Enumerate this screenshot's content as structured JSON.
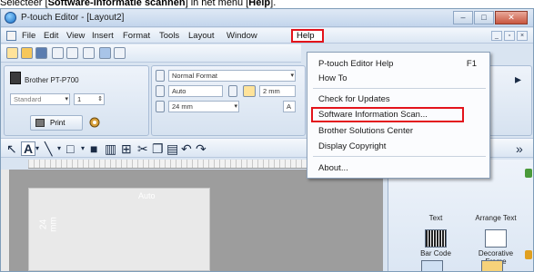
{
  "instruction": {
    "prefix": "Selecteer [",
    "bold1": "Software-informatie scannen",
    "middle": "] in het menu [",
    "bold2": "Help",
    "suffix": "]."
  },
  "window": {
    "title": "P-touch Editor - [Layout2]",
    "controls": {
      "minimize": "–",
      "maximize": "□",
      "close": "✕"
    }
  },
  "menubar": {
    "items": [
      "File",
      "Edit",
      "View",
      "Insert",
      "Format",
      "Tools",
      "Layout",
      "Window"
    ],
    "help": "Help"
  },
  "printer_panel": {
    "printer_name": "Brother PT-P700",
    "mode": "Standard",
    "copies": "1",
    "print_label": "Print"
  },
  "format_panel": {
    "format": "Normal Format",
    "length": "Auto",
    "margin": "2 mm",
    "tape_width": "24 mm",
    "text_style": "A"
  },
  "canvas": {
    "tape_length": "24 mm",
    "auto_label": "Auto"
  },
  "sidebar": {
    "items": [
      "Text",
      "Arrange Text",
      "Bar Code",
      "Decorative Frame"
    ]
  },
  "help_menu": {
    "items": [
      {
        "label": "P-touch Editor Help",
        "shortcut": "F1"
      },
      {
        "label": "How To",
        "shortcut": ""
      },
      {
        "label": "Check for Updates",
        "shortcut": ""
      },
      {
        "label": "Software Information Scan...",
        "shortcut": ""
      },
      {
        "label": "Brother Solutions Center",
        "shortcut": ""
      },
      {
        "label": "Display Copyright",
        "shortcut": ""
      },
      {
        "label": "About...",
        "shortcut": ""
      }
    ]
  },
  "colors": {
    "highlight": "#e3131b",
    "window_chrome": "#d9e4f1"
  }
}
